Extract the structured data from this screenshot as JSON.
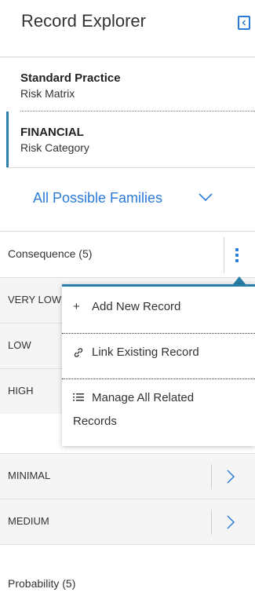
{
  "header": {
    "title": "Record Explorer"
  },
  "cards": [
    {
      "title": "Standard Practice",
      "subtitle": "Risk Matrix"
    },
    {
      "title": "FINANCIAL",
      "subtitle": "Risk Category"
    }
  ],
  "family_select": {
    "value": "All Possible Families"
  },
  "consequence": {
    "label": "Consequence (5)",
    "rows": [
      "VERY LOW",
      "LOW",
      "HIGH",
      "MINIMAL",
      "MEDIUM"
    ]
  },
  "popup_menu": {
    "add": {
      "icon": "+",
      "label": "Add New Record"
    },
    "link": {
      "icon": "🔗",
      "label": "Link Existing Record"
    },
    "manage": {
      "icon": "☰",
      "label_line1": "Manage All Related",
      "label_line2": "Records"
    }
  },
  "probability": {
    "label": "Probability (5)"
  },
  "colors": {
    "accent": "#2c7bd6",
    "teal": "#2a7fa8"
  }
}
